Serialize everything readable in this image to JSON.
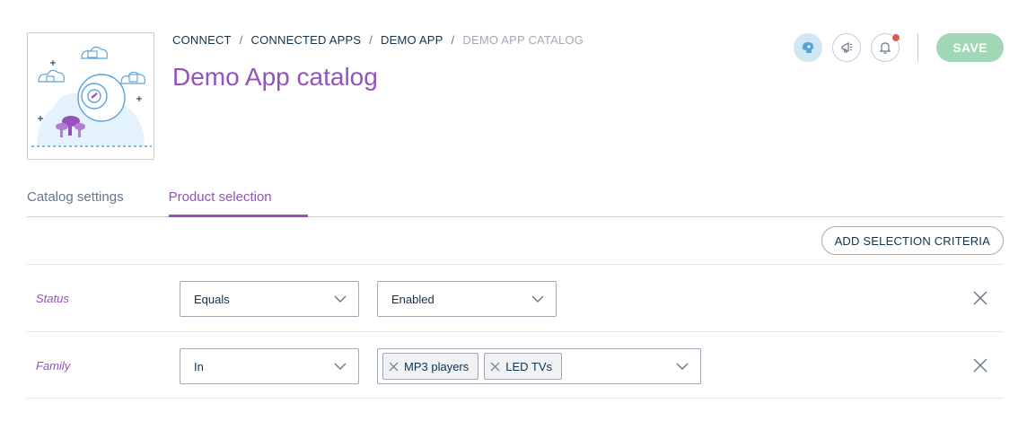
{
  "breadcrumb": {
    "items": [
      "CONNECT",
      "CONNECTED APPS",
      "DEMO APP",
      "DEMO APP CATALOG"
    ],
    "separator": "/"
  },
  "page": {
    "title": "Demo App catalog"
  },
  "header_actions": {
    "save_label": "SAVE",
    "notification_badge": true
  },
  "tabs": [
    {
      "label": "Catalog settings",
      "active": false
    },
    {
      "label": "Product selection",
      "active": true
    }
  ],
  "add_criteria_label": "ADD SELECTION CRITERIA",
  "criteria": [
    {
      "field": "Status",
      "operator": "Equals",
      "value": "Enabled"
    },
    {
      "field": "Family",
      "operator": "In",
      "values": [
        "MP3 players",
        "LED TVs"
      ]
    }
  ],
  "colors": {
    "accent": "#9452ba",
    "text": "#11324d",
    "muted": "#a1a9b7",
    "save": "#a0d8b5",
    "badge": "#d4604f"
  }
}
